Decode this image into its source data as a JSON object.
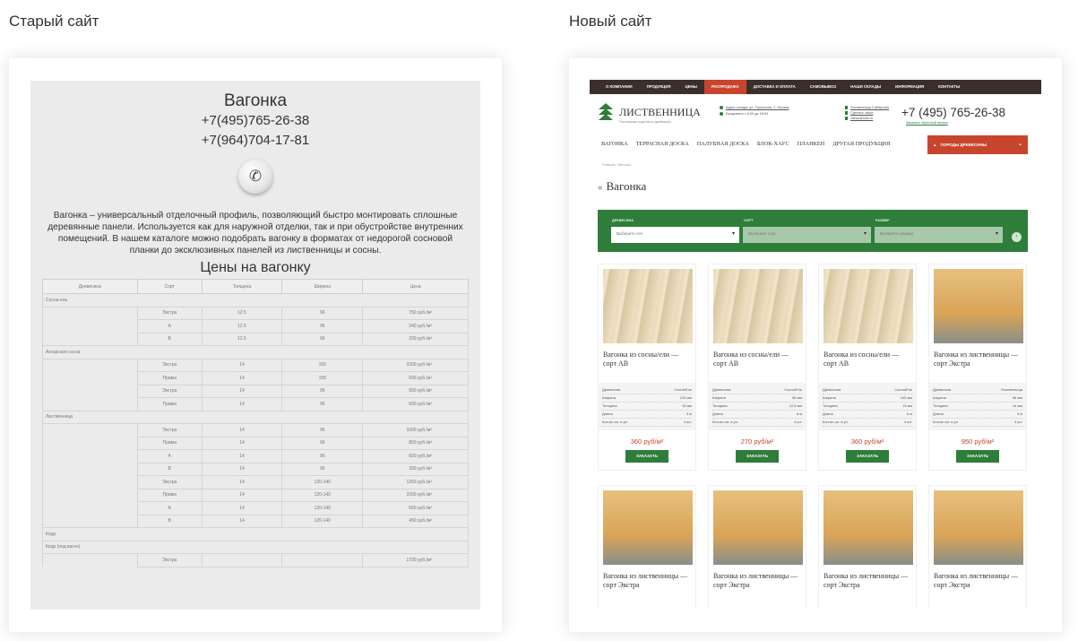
{
  "captions": {
    "old": "Старый сайт",
    "new": "Новый сайт"
  },
  "old_site": {
    "title": "Вагонка",
    "phone1": "+7(495)765-26-38",
    "phone2": "+7(964)704-17-81",
    "call_icon": "phone-icon",
    "description": "Вагонка – универсальный отделочный профиль, позволяющий быстро монтировать сплошные деревянные панели. Используется как для наружной отделки, так и при обустройстве внутренних помещений. В нашем каталоге можно подобрать вагонку в форматах от недорогой сосновой планки до эксклюзивных панелей из лиственницы и сосны.",
    "price_title": "Цены на вагонку",
    "table": {
      "headers": [
        "Древесина",
        "Сорт",
        "Толщина",
        "Ширина",
        "Цена"
      ],
      "rows": [
        {
          "group": "Сосна-ель"
        },
        {
          "sort": "Экстра",
          "thickness": "12.5",
          "width": "96",
          "price": "750 руб./м²"
        },
        {
          "sort": "А",
          "thickness": "12.5",
          "width": "96",
          "price": "240 руб./м²"
        },
        {
          "sort": "В",
          "thickness": "12.5",
          "width": "96",
          "price": "200 руб./м²"
        },
        {
          "group": "Ангарская сосна"
        },
        {
          "sort": "Экстра",
          "thickness": "14",
          "width": "150",
          "price": "1000 руб./м²"
        },
        {
          "sort": "Прима",
          "thickness": "14",
          "width": "150",
          "price": "600 руб./м²"
        },
        {
          "sort": "Экстра",
          "thickness": "14",
          "width": "96",
          "price": "900 руб./м²"
        },
        {
          "sort": "Прима",
          "thickness": "14",
          "width": "96",
          "price": "600 руб./м²"
        },
        {
          "group": "Лиственница"
        },
        {
          "sort": "Экстра",
          "thickness": "14",
          "width": "96",
          "price": "1000 руб./м²"
        },
        {
          "sort": "Прима",
          "thickness": "14",
          "width": "96",
          "price": "850 руб./м²"
        },
        {
          "sort": "А",
          "thickness": "14",
          "width": "96",
          "price": "600 руб./м²"
        },
        {
          "sort": "В",
          "thickness": "14",
          "width": "96",
          "price": "390 руб./м²"
        },
        {
          "sort": "Экстра",
          "thickness": "14",
          "width": "120-140",
          "price": "1250 руб./м²"
        },
        {
          "sort": "Прима",
          "thickness": "14",
          "width": "120-140",
          "price": "1000 руб./м²"
        },
        {
          "sort": "А",
          "thickness": "14",
          "width": "120-140",
          "price": "650 руб./м²"
        },
        {
          "sort": "В",
          "thickness": "14",
          "width": "120-140",
          "price": "450 руб./м²"
        },
        {
          "group": "Кедр"
        },
        {
          "group": "Кедр (под вагон)"
        },
        {
          "sort": "Экстра",
          "thickness": "",
          "width": "",
          "price": "1700 руб./м²"
        }
      ]
    }
  },
  "new_site": {
    "top_nav": [
      "О КОМПАНИИ",
      "ПРОДУКЦИЯ",
      "ЦЕНЫ",
      "РАСПРОДАЖА",
      "ДОСТАВКА И ОПЛАТА",
      "САМОВЫВОЗ",
      "НАШИ СКЛАДЫ",
      "ИНФОРМАЦИЯ",
      "КОНТАКТЫ"
    ],
    "top_nav_active": "РАСПРОДАЖА",
    "logo_text": "ЛИСТВЕННИЦА",
    "logo_sub": "Погонажные изделия из древесины",
    "address": "Адрес склада: ул. Угрешская, 2, Москва",
    "hours": "Ежедневно с 9:00 до 18:00",
    "contact_links": [
      "Лиственница Сибирская",
      "Сделать заказ",
      "zakaz@mail.ru"
    ],
    "phone": "+7 (495) 765-26-38",
    "callback": "Заказать обратный звонок",
    "cat_nav": [
      "ВАГОНКА",
      "ТЕРРАСНАЯ ДОСКА",
      "ПАЛУБНАЯ ДОСКА",
      "БЛОК-ХАУС",
      "ПЛАНКЕН",
      "ДРУГАЯ ПРОДУКЦИЯ"
    ],
    "all_products": "ПОРОДЫ ДРЕВЕСИНЫ",
    "breadcrumb": "Главная / Вагонка",
    "page_title": "Вагонка",
    "filter": {
      "wood_label": "ДРЕВЕСИНА",
      "wood_placeholder": "Выберите сел",
      "sort_label": "СОРТ",
      "sort_placeholder": "Выберите сорт",
      "size_label": "РАЗМЕР",
      "size_placeholder": "Выберите размер"
    },
    "products": [
      {
        "title": "Вагонка из сосны/ели — сорт АВ",
        "wood": "Сосна/Ель",
        "width": "120 мм",
        "thickness": "13 мм",
        "length": "3 м",
        "qty": "4 шт.",
        "price": "360 руб/м²",
        "img": "pine"
      },
      {
        "title": "Вагонка из сосны/ели — сорт АВ",
        "wood": "Сосна/Ель",
        "width": "96 мм",
        "thickness": "12,5 мм",
        "length": "6 м",
        "qty": "4 шт.",
        "price": "270 руб/м²",
        "img": "pine"
      },
      {
        "title": "Вагонка из сосны/ели — сорт АВ",
        "wood": "Сосна/Ель",
        "width": "140 мм",
        "thickness": "13 мм",
        "length": "6 м",
        "qty": "4 шт.",
        "price": "360 руб/м²",
        "img": "pine"
      },
      {
        "title": "Вагонка из лиственницы — сорт Экстра",
        "wood": "Лиственница",
        "width": "96 мм",
        "thickness": "14 мм",
        "length": "3 м",
        "qty": "4 шт.",
        "price": "950 руб/м²",
        "img": "larch"
      },
      {
        "title": "Вагонка из лиственницы — сорт Экстра",
        "img": "larch"
      },
      {
        "title": "Вагонка из лиственницы — сорт Экстра",
        "img": "larch"
      },
      {
        "title": "Вагонка из лиственницы — сорт Экстра",
        "img": "larch"
      },
      {
        "title": "Вагонка из лиственницы — сорт Экстра",
        "img": "larch"
      }
    ],
    "spec_labels": {
      "wood": "Древесина",
      "width": "Ширина",
      "thickness": "Толщина",
      "length": "Длина",
      "qty": "Кол-во шт. в уп."
    },
    "order_button": "ЗАКАЗАТЬ"
  }
}
